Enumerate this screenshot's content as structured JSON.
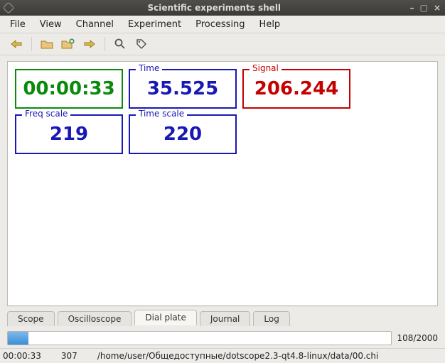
{
  "titlebar": {
    "title": "Scientific experiments shell"
  },
  "menu": {
    "file": "File",
    "view": "View",
    "channel": "Channel",
    "experiment": "Experiment",
    "processing": "Processing",
    "help": "Help"
  },
  "toolbar": {
    "back": "back-arrow",
    "open": "open-folder",
    "open_add": "open-add",
    "forward": "forward-arrow",
    "zoom": "zoom",
    "tag": "tag"
  },
  "dials": {
    "clock": {
      "value": "00:00:33"
    },
    "time": {
      "label": "Time",
      "value": "35.525"
    },
    "signal": {
      "label": "Signal",
      "value": "206.244"
    },
    "freq_scale": {
      "label": "Freq scale",
      "value": "219"
    },
    "time_scale": {
      "label": "Time scale",
      "value": "220"
    }
  },
  "tabs": {
    "scope": "Scope",
    "oscilloscope": "Oscilloscope",
    "dial_plate": "Dial plate",
    "journal": "Journal",
    "log": "Log",
    "active": "dial_plate"
  },
  "progress": {
    "current": 108,
    "total": 2000,
    "label": "108/2000"
  },
  "status": {
    "timestamp": "00:00:33",
    "count": "307",
    "path": "/home/user/Общедоступные/dotscope2.3-qt4.8-linux/data/00.chi"
  }
}
